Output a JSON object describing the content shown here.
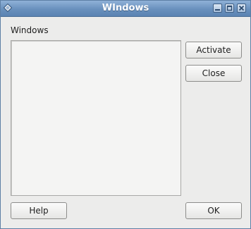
{
  "window": {
    "title": "WIndows",
    "controls": {
      "minimize": "minimize-icon",
      "maximize": "maximize-icon",
      "close": "close-icon"
    },
    "app_icon": "diamond-icon",
    "accent_color": "#6990bd"
  },
  "main": {
    "list_label": "Windows",
    "list_items": []
  },
  "buttons": {
    "activate": "Activate",
    "close": "Close",
    "help": "Help",
    "ok": "OK"
  }
}
